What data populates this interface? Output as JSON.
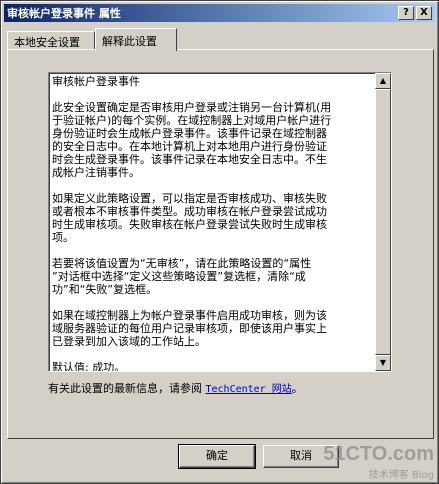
{
  "window": {
    "title": "审核帐户登录事件 属性",
    "help_button": "?",
    "close_button": "X"
  },
  "tabs": [
    {
      "label": "本地安全设置",
      "active": false
    },
    {
      "label": "解释此设置",
      "active": true
    }
  ],
  "explanation": {
    "text": "审核帐户登录事件\n\n此安全设置确定是否审核用户登录或注销另一台计算机(用\n于验证帐户)的每个实例。在域控制器上对域用户帐户进行\n身份验证时会生成帐户登录事件。该事件记录在域控制器\n的安全日志中。在本地计算机上对本地用户进行身份验证\n时会生成登录事件。该事件记录在本地安全日志中。不生\n成帐户注销事件。\n\n如果定义此策略设置，可以指定是否审核成功、审核失败\n或者根本不审核事件类型。成功审核在帐户登录尝试成功\n时生成审核项。失败审核在帐户登录尝试失败时生成审核\n项。\n\n若要将该值设置为“无审核”，请在此策略设置的“属性\n”对话框中选择“定义这些策略设置”复选框，清除“成\n功”和“失败”复选框。\n\n如果在域控制器上为帐户登录事件启用成功审核，则为该\n域服务器验证的每位用户记录审核项，即使该用户事实上\n已登录到加入该域的工作站上。\n\n默认值: 成功。"
  },
  "more_info": {
    "prefix": "有关此设置的最新信息，请参阅 ",
    "link": "TechCenter 网站",
    "suffix": "。"
  },
  "buttons": {
    "ok": "确定",
    "cancel": "取消"
  },
  "watermark": {
    "main": "51CTO.com",
    "sub": "技术博客 Blog"
  }
}
